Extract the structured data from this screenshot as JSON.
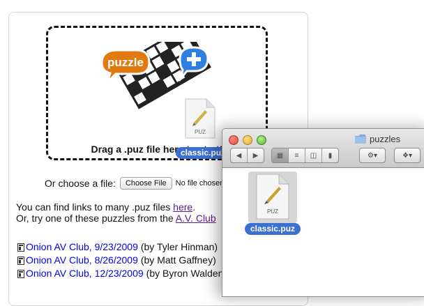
{
  "dropzone": {
    "logo_text": "puzzle",
    "instruction": "Drag a .puz file here to start!"
  },
  "choose": {
    "label": "Or choose a file:",
    "button": "Choose File",
    "status": "No file chosen"
  },
  "intro": {
    "line1_pre": "You can find links to many .puz files ",
    "line1_link": "here",
    "line1_post": ".",
    "line2_pre": "Or, try one of these puzzles from the ",
    "line2_link": "A.V. Club"
  },
  "puzzles": [
    {
      "title": "Onion AV Club, 9/23/2009",
      "by": "(by Tyler Hinman)"
    },
    {
      "title": "Onion AV Club, 8/26/2009",
      "by": "(by Matt Gaffney)"
    },
    {
      "title": "Onion AV Club, 12/23/2009",
      "by": "(by Byron Walden)"
    }
  ],
  "dragged_file": {
    "name": "classic.puz",
    "icon_label": "PUZ"
  },
  "finder": {
    "title": "puzzles",
    "file_name": "classic.puz",
    "file_icon_label": "PUZ"
  },
  "colors": {
    "selection": "#3b6fd0",
    "link": "#0000ee",
    "visited_link": "#551a8b",
    "logo_orange": "#e07a10",
    "logo_blue": "#2f7fe0"
  }
}
